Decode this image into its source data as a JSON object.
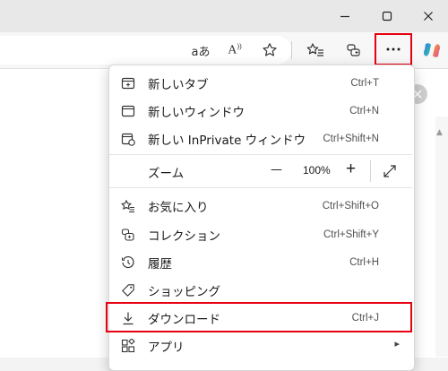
{
  "titlebar": {
    "minimize_icon": "minimize-icon",
    "maximize_icon": "maximize-icon",
    "close_icon": "close-icon"
  },
  "toolbar": {
    "read_aloud_text": "aあ",
    "read_aloud_voice": "A",
    "icons": [
      "immersive-reader-icon",
      "read-aloud-icon",
      "favorite-star-icon",
      "favorites-icon",
      "collections-icon",
      "more-icon",
      "copilot-icon"
    ]
  },
  "menu": {
    "items": [
      {
        "label": "新しいタブ",
        "shortcut": "Ctrl+T",
        "icon": "new-tab-icon"
      },
      {
        "label": "新しいウィンドウ",
        "shortcut": "Ctrl+N",
        "icon": "new-window-icon"
      },
      {
        "label": "新しい InPrivate ウィンドウ",
        "shortcut": "Ctrl+Shift+N",
        "icon": "inprivate-icon"
      }
    ],
    "zoom": {
      "label": "ズーム",
      "minus": "—",
      "value": "100%",
      "plus": "+",
      "fullscreen_icon": "fullscreen-icon"
    },
    "items2": [
      {
        "label": "お気に入り",
        "shortcut": "Ctrl+Shift+O",
        "icon": "favorites-icon"
      },
      {
        "label": "コレクション",
        "shortcut": "Ctrl+Shift+Y",
        "icon": "collections-icon"
      },
      {
        "label": "履歴",
        "shortcut": "Ctrl+H",
        "icon": "history-icon"
      },
      {
        "label": "ショッピング",
        "shortcut": "",
        "icon": "shopping-tag-icon"
      },
      {
        "label": "ダウンロード",
        "shortcut": "Ctrl+J",
        "icon": "download-icon"
      },
      {
        "label": "アプリ",
        "shortcut": "",
        "icon": "apps-icon",
        "submenu": "▸"
      }
    ]
  },
  "highlight_color": "#e60012"
}
